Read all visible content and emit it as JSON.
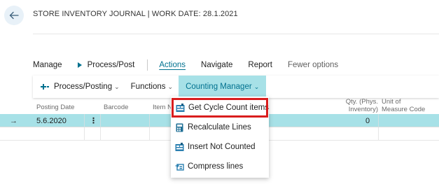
{
  "page": {
    "title": "STORE INVENTORY JOURNAL | WORK DATE: 28.1.2021"
  },
  "action_bar": {
    "items": [
      "Manage",
      "Process/Post",
      "Actions",
      "Navigate",
      "Report",
      "Fewer options"
    ],
    "active": "Actions"
  },
  "sub_bar": {
    "items": [
      "Process/Posting",
      "Functions",
      "Counting Manager"
    ],
    "open": "Counting Manager"
  },
  "grid": {
    "columns": {
      "posting_date": "Posting Date",
      "barcode": "Barcode",
      "item_no": "Item N",
      "qty_line1": "Qty. (Phys.",
      "qty_line2": "Inventory)",
      "uom_line1": "Unit of",
      "uom_line2": "Measure Code"
    },
    "rows": [
      {
        "arrow": "→",
        "posting_date": "5.6.2020",
        "menu": "⋮",
        "qty": "0"
      }
    ]
  },
  "dropdown": {
    "items": [
      {
        "label": "Get Cycle Count items",
        "icon": "worksheet-icon",
        "highlighted": true
      },
      {
        "label": "Recalculate Lines",
        "icon": "calculator-icon"
      },
      {
        "label": "Insert Not Counted",
        "icon": "worksheet-icon"
      },
      {
        "label": "Compress lines",
        "icon": "compress-icon"
      }
    ]
  },
  "colors": {
    "accent": "#00718f",
    "selection": "#a7e1e7",
    "highlight_border": "#d91e1e"
  }
}
